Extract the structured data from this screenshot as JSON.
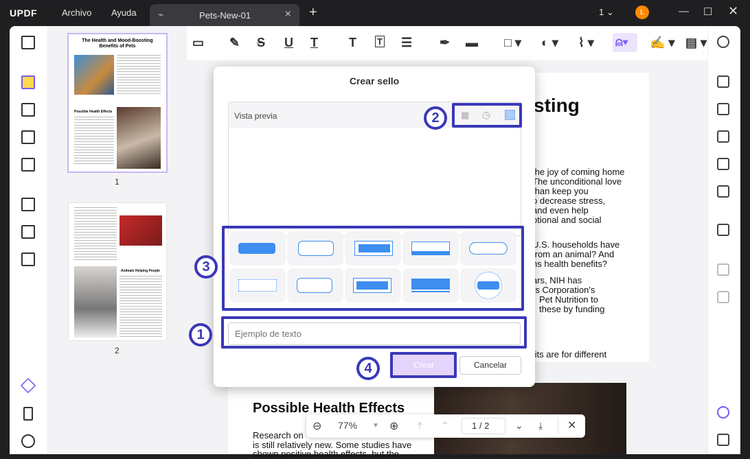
{
  "app": {
    "logo": "UPDF",
    "menu": [
      "Archivo",
      "Ayuda"
    ],
    "tab_title": "Pets-New-01",
    "page_indicator": "1",
    "avatar_initial": "L",
    "accent": "#3a38b8"
  },
  "thumbnails": {
    "page1_label": "1",
    "page2_label": "2",
    "page1_title": "The Health and Mood-Boosting Benefits of Pets",
    "page1_section": "Possible Health Effects",
    "page2_section": "Animals Helping People"
  },
  "document": {
    "heading_fragment": "sting",
    "body_lines": [
      "the joy of coming home",
      "The unconditional love",
      "than keep you",
      "p decrease stress,",
      "and even help",
      "otional and social",
      "U.S. households have",
      "from an animal? And",
      "ns health benefits?",
      "ars, NIH has",
      "rs Corporation's",
      "Pet Nutrition to",
      "these by funding",
      "fits are for different"
    ],
    "section_heading": "Possible Health Effects",
    "bottom_lines": [
      "Research on",
      "is still relatively new. Some studies have",
      "shown positive health effects, but the"
    ]
  },
  "dialog": {
    "title": "Crear sello",
    "preview_label": "Vista previa",
    "input_placeholder": "Ejemplo de texto",
    "create_label": "Crear",
    "cancel_label": "Cancelar",
    "badges": [
      "1",
      "2",
      "3",
      "4"
    ],
    "stamp_options": [
      "solid-rect",
      "arrow-left-outline",
      "arrow-left-double",
      "underline-bar",
      "rounded-outline",
      "dotted-outline",
      "arrow-right-outline",
      "arrow-right-double",
      "solid-bar",
      "circle-badge"
    ]
  },
  "zoom": {
    "value": "77%",
    "current_page": "1",
    "separator": "/",
    "total_pages": "2"
  }
}
